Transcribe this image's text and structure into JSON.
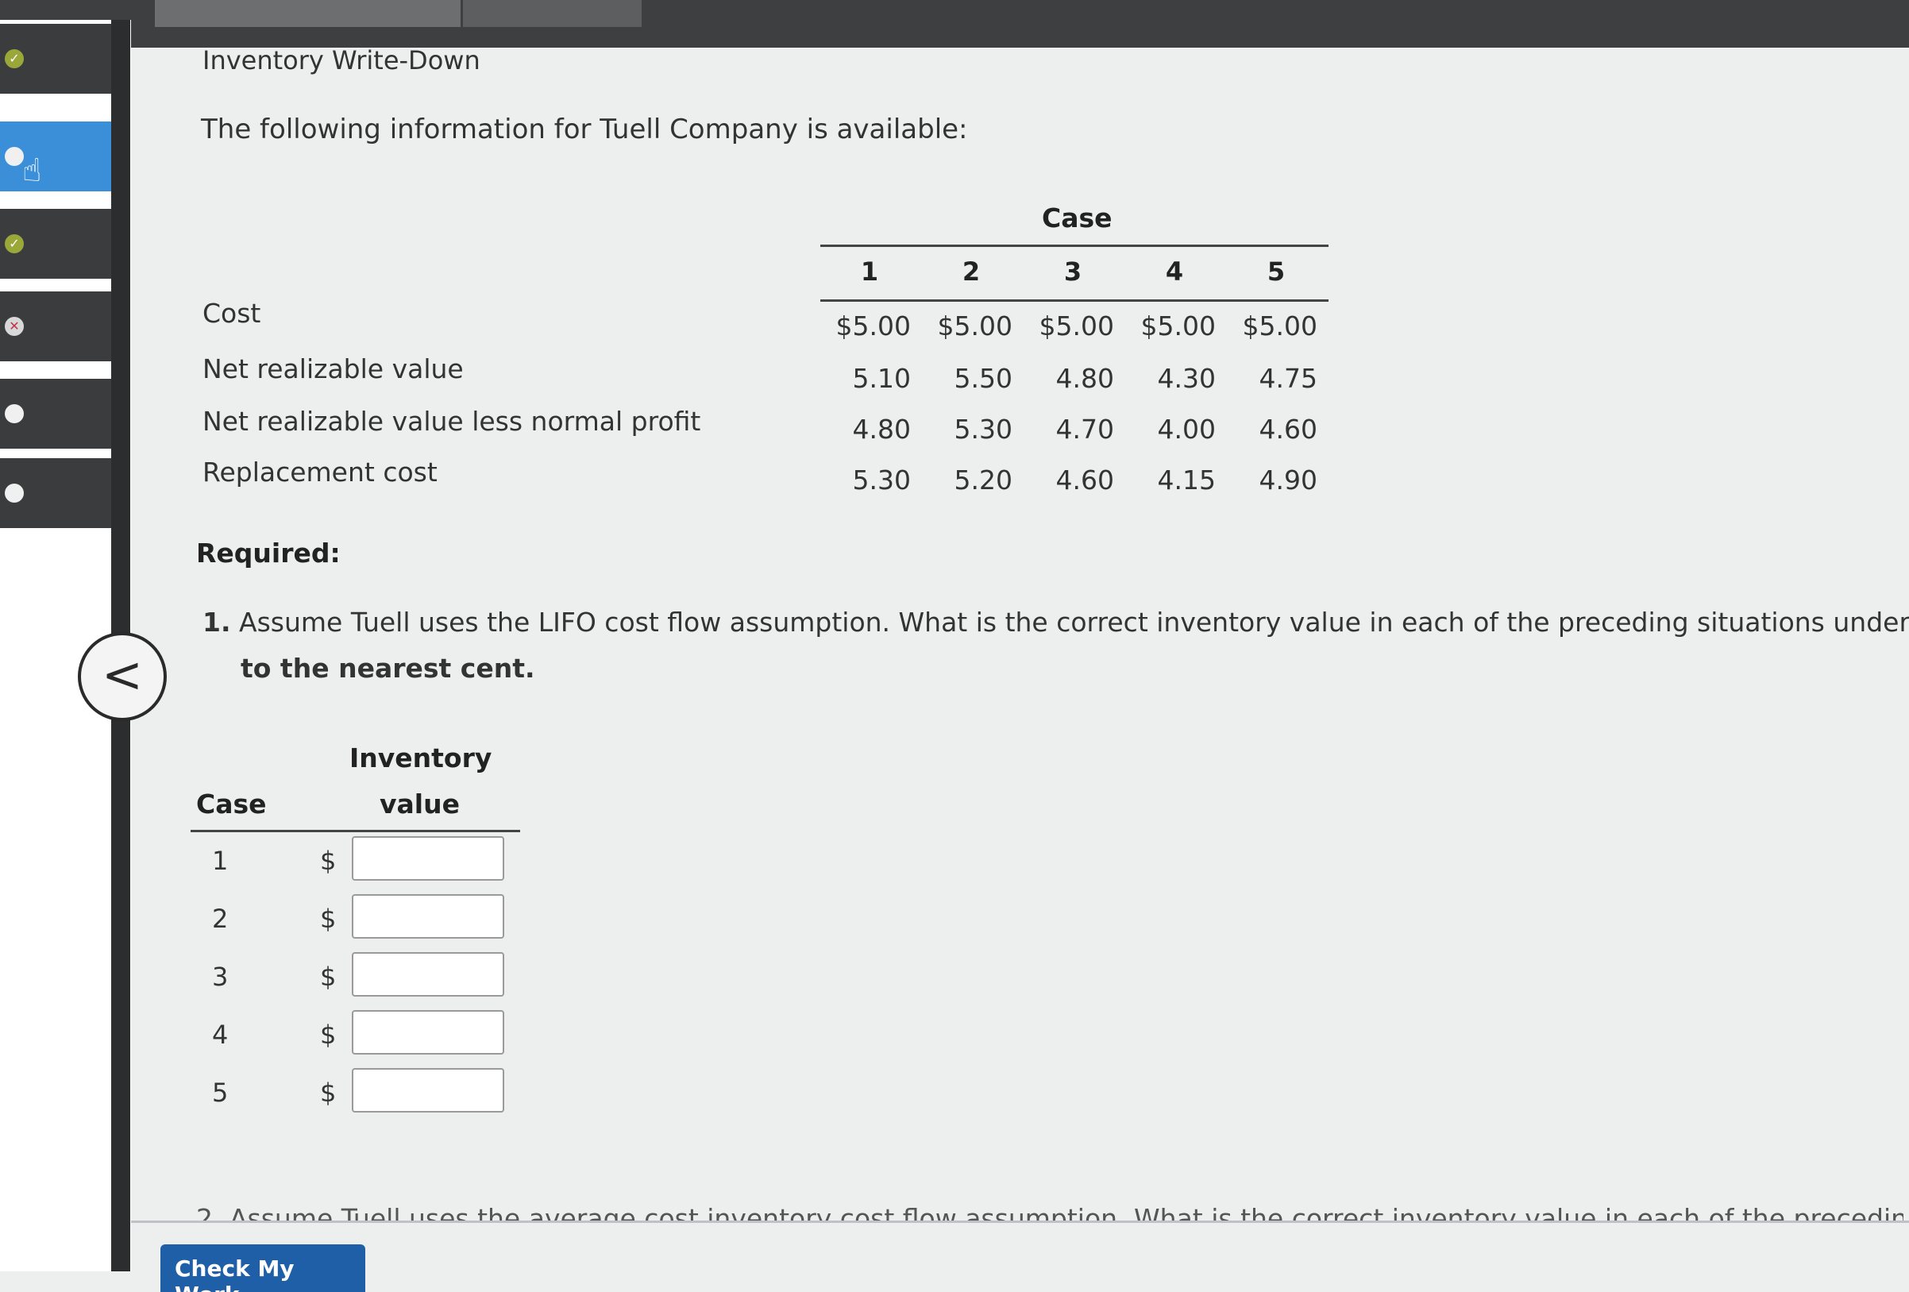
{
  "sidebar": {
    "items": [
      {
        "status": "complete",
        "icon": "check-icon"
      },
      {
        "status": "active",
        "icon": "circle-icon"
      },
      {
        "status": "complete",
        "icon": "check-icon"
      },
      {
        "status": "incorrect",
        "icon": "x-icon"
      },
      {
        "status": "not-started",
        "icon": "circle-icon"
      },
      {
        "status": "not-started",
        "icon": "circle-icon"
      }
    ],
    "back_label": "<"
  },
  "main": {
    "title": "Inventory Write-Down",
    "intro": "The following information for Tuell Company is available:",
    "table": {
      "header": "Case",
      "columns": [
        "1",
        "2",
        "3",
        "4",
        "5"
      ],
      "rows": [
        {
          "label": "Cost",
          "values": [
            "$5.00",
            "$5.00",
            "$5.00",
            "$5.00",
            "$5.00"
          ]
        },
        {
          "label": "Net realizable value",
          "values": [
            "5.10",
            "5.50",
            "4.80",
            "4.30",
            "4.75"
          ]
        },
        {
          "label": "Net realizable value less normal profit",
          "values": [
            "4.80",
            "5.30",
            "4.70",
            "4.00",
            "4.60"
          ]
        },
        {
          "label": "Replacement cost",
          "values": [
            "5.30",
            "5.20",
            "4.60",
            "4.15",
            "4.90"
          ]
        }
      ]
    },
    "required_label": "Required:",
    "question1": {
      "number": "1.",
      "text": "Assume Tuell uses the LIFO cost flow assumption. What is the correct inventory value in each of the preceding situations under U.S.",
      "continuation": "to the nearest cent."
    },
    "answer_table": {
      "header_inventory": "Inventory",
      "header_case": "Case",
      "header_value": "value",
      "currency": "$",
      "rows": [
        {
          "case": "1",
          "value": ""
        },
        {
          "case": "2",
          "value": ""
        },
        {
          "case": "3",
          "value": ""
        },
        {
          "case": "4",
          "value": ""
        },
        {
          "case": "5",
          "value": ""
        }
      ]
    },
    "question2_partial": "2. Assume Tuell uses the average cost inventory cost flow assumption. What is the correct inventory value in each of the preceding sit"
  },
  "footer": {
    "check_button": "Check My Work"
  }
}
